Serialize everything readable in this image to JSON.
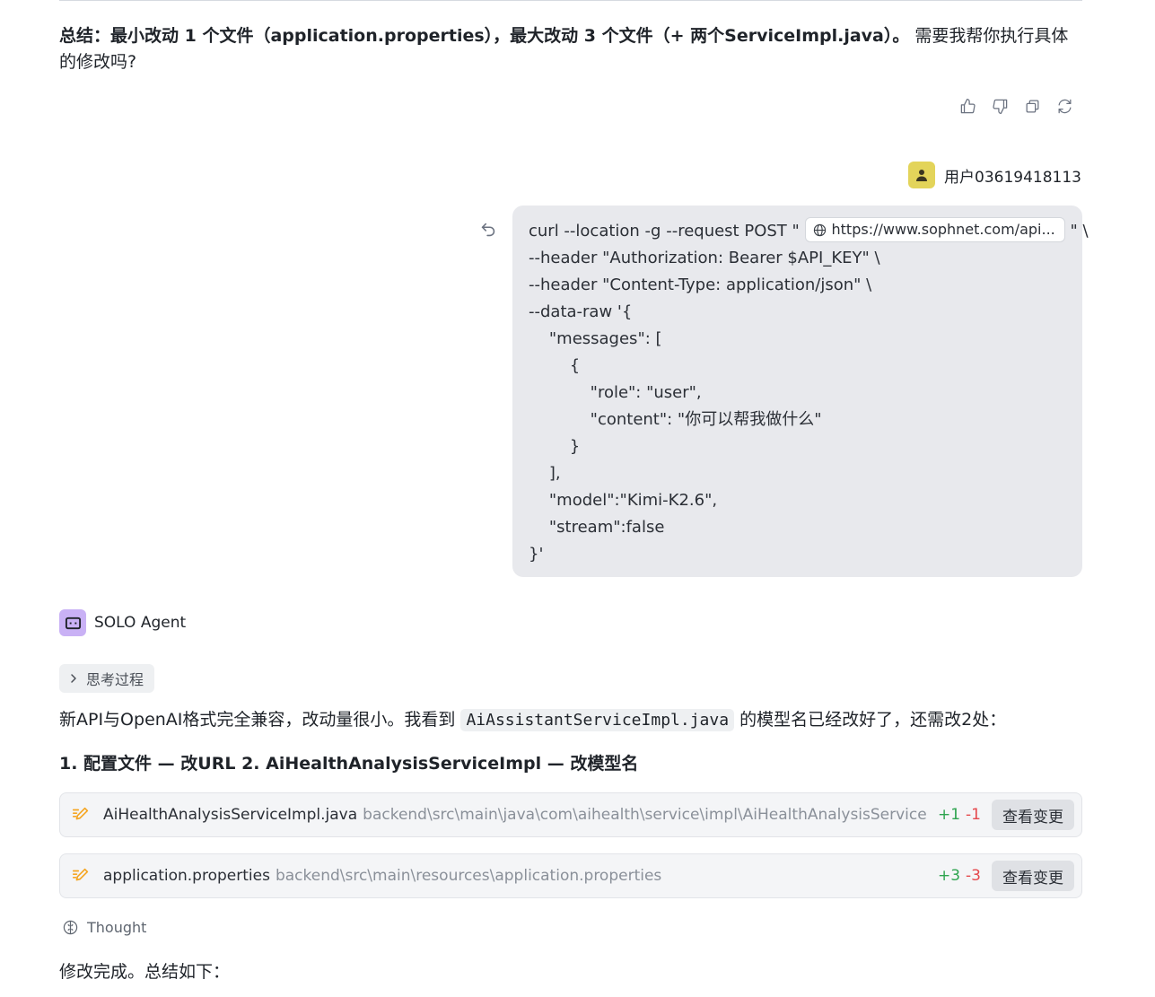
{
  "summary": {
    "bold": "总结：最小改动 1 个文件（application.properties），最大改动 3 个文件（+ 两个ServiceImpl.java）。",
    "rest": " 需要我帮你执行具体的修改吗?"
  },
  "message_actions": {
    "icons": [
      "thumbs-up-icon",
      "thumbs-down-icon",
      "copy-icon",
      "refresh-icon"
    ]
  },
  "user": {
    "name": "用户03619418113",
    "avatar_color": "#e3d45a"
  },
  "user_message": {
    "line1_before": "curl --location -g --request POST \"",
    "url": "https://www.sophnet.com/api...",
    "line1_after": "\" \\",
    "lines": [
      "--header \"Authorization: Bearer $API_KEY\" \\",
      "--header \"Content-Type: application/json\" \\",
      "--data-raw '{",
      "    \"messages\": [",
      "        {",
      "            \"role\": \"user\",",
      "            \"content\": \"你可以帮我做什么\"",
      "        }",
      "    ],",
      "    \"model\":\"Kimi-K2.6\",",
      "    \"stream\":false",
      "}'"
    ]
  },
  "agent": {
    "name": "SOLO Agent",
    "logo_color": "#c9b1f5",
    "thinking_label": "思考过程",
    "paragraph_before": "新API与OpenAI格式完全兼容，改动量很小。我看到 ",
    "paragraph_code": "AiAssistantServiceImpl.java",
    "paragraph_after": " 的模型名已经改好了，还需改2处：",
    "heading": "1. 配置文件 — 改URL 2. AiHealthAnalysisServiceImpl — 改模型名",
    "files": [
      {
        "name": "AiHealthAnalysisServiceImpl.java",
        "path": "backend\\src\\main\\java\\com\\aihealth\\service\\impl\\AiHealthAnalysisServiceImpl.java",
        "added": "+1",
        "removed": "-1",
        "button": "查看变更"
      },
      {
        "name": "application.properties",
        "path": "backend\\src\\main\\resources\\application.properties",
        "added": "+3",
        "removed": "-3",
        "button": "查看变更"
      }
    ],
    "thought_label": "Thought",
    "final_text": "修改完成。总结如下："
  },
  "colors": {
    "diff_add": "#2ea44f",
    "diff_del": "#e5484d",
    "pen_icon": "#f5a623"
  }
}
